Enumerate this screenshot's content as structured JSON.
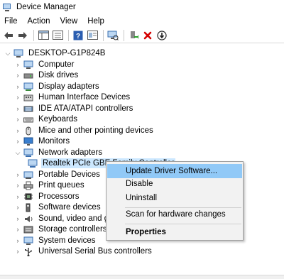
{
  "window": {
    "title": "Device Manager"
  },
  "menu": [
    "File",
    "Action",
    "View",
    "Help"
  ],
  "toolbar": {
    "buttons": [
      "back-arrow-icon",
      "forward-arrow-icon",
      "show-hide-tree-icon",
      "properties-icon",
      "help-icon",
      "scan-hardware-icon",
      "update-driver-icon",
      "uninstall-icon",
      "disable-icon"
    ]
  },
  "tree": {
    "root": "DESKTOP-G1P824B",
    "categories": [
      "Computer",
      "Disk drives",
      "Display adapters",
      "Human Interface Devices",
      "IDE ATA/ATAPI controllers",
      "Keyboards",
      "Mice and other pointing devices",
      "Monitors",
      "Network adapters",
      "Realtek PCIe GBE Family Controller",
      "Portable Devices",
      "Print queues",
      "Processors",
      "Software devices",
      "Sound, video and ga",
      "Storage controllers",
      "System devices",
      "Universal Serial Bus controllers"
    ]
  },
  "context_menu": {
    "items": [
      "Update Driver Software...",
      "Disable",
      "Uninstall",
      "Scan for hardware changes",
      "Properties"
    ]
  },
  "colors": {
    "selection": "#cce8ff",
    "menu_highlight": "#91c9f7",
    "menu_bg": "#f2f2f2"
  }
}
